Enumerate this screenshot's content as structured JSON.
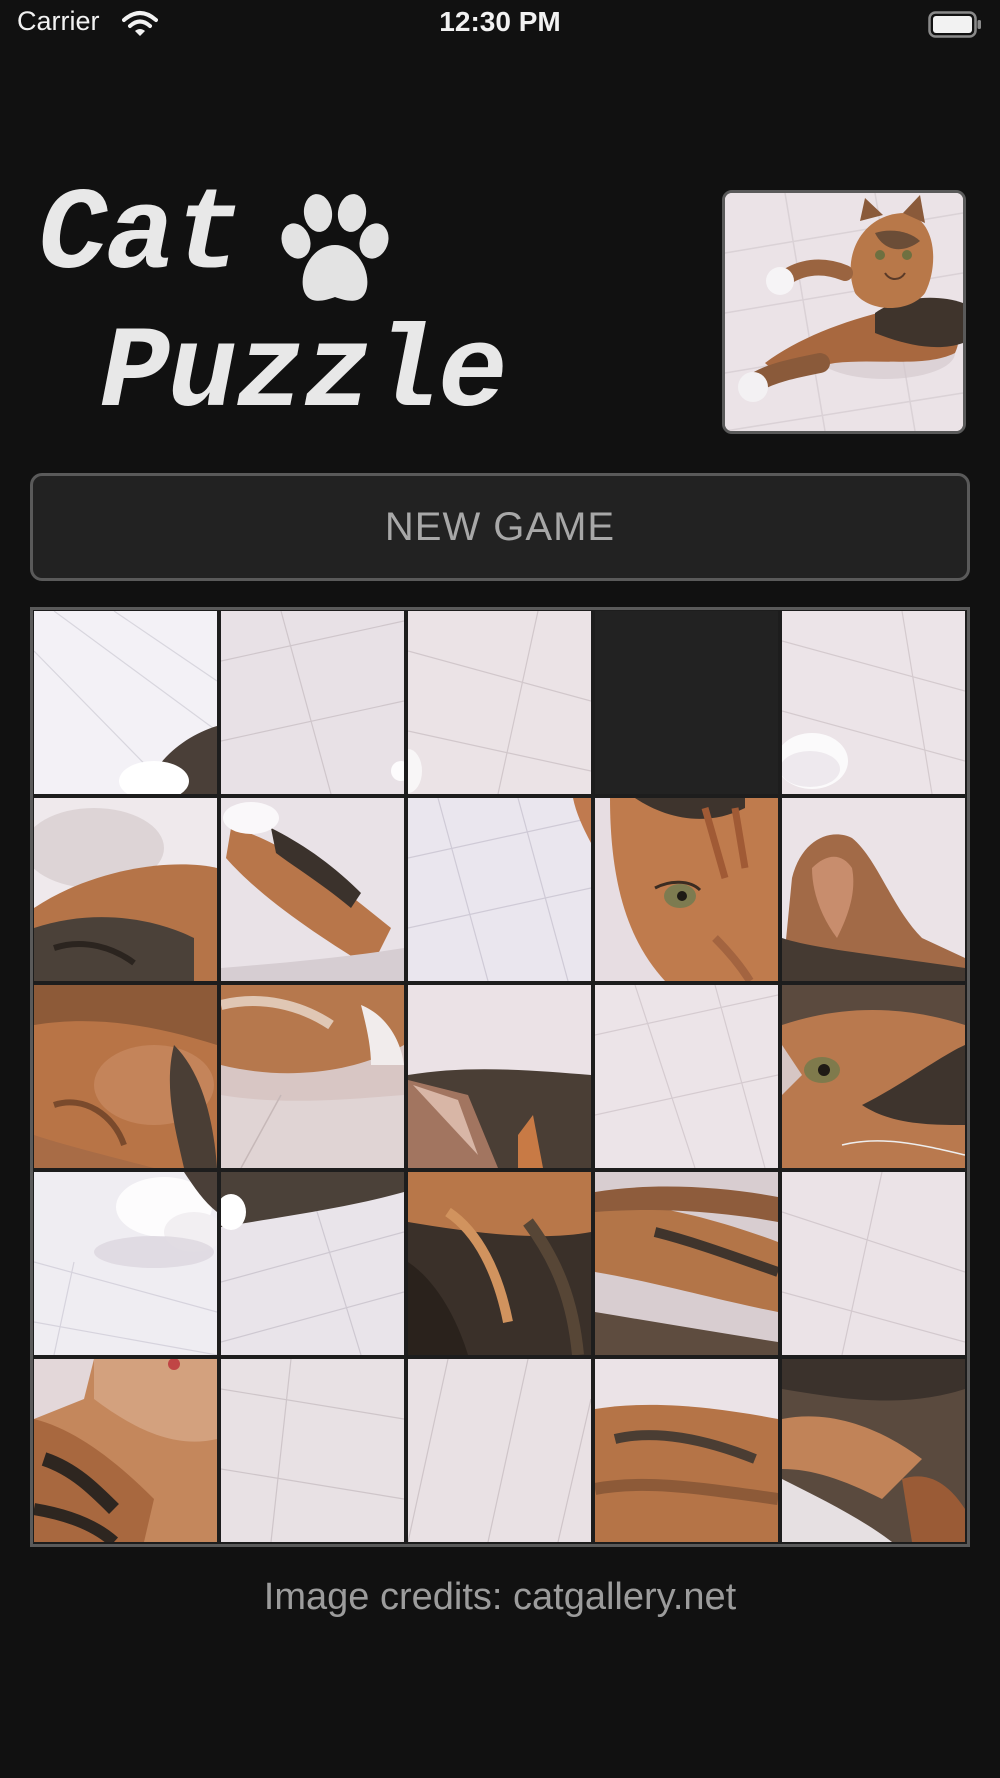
{
  "status_bar": {
    "carrier": "Carrier",
    "time": "12:30 PM"
  },
  "title": {
    "line1": "Cat",
    "line2": "Puzzle"
  },
  "new_game_button": {
    "label": "NEW GAME"
  },
  "credits": "Image credits: catgallery.net",
  "board": {
    "rows": 5,
    "columns": 5,
    "empty_position": {
      "row": 1,
      "col": 4
    },
    "tiles": [
      {
        "row": 1,
        "col": 1,
        "content": "floor with white paw"
      },
      {
        "row": 1,
        "col": 2,
        "content": "floor"
      },
      {
        "row": 1,
        "col": 3,
        "content": "floor"
      },
      {
        "row": 1,
        "col": 4,
        "content": "empty"
      },
      {
        "row": 1,
        "col": 5,
        "content": "floor with white paw"
      },
      {
        "row": 2,
        "col": 1,
        "content": "cat fur"
      },
      {
        "row": 2,
        "col": 2,
        "content": "cat leg"
      },
      {
        "row": 2,
        "col": 3,
        "content": "floor"
      },
      {
        "row": 2,
        "col": 4,
        "content": "cat face with eye"
      },
      {
        "row": 2,
        "col": 5,
        "content": "cat ear"
      },
      {
        "row": 3,
        "col": 1,
        "content": "cat fur"
      },
      {
        "row": 3,
        "col": 2,
        "content": "cat fur"
      },
      {
        "row": 3,
        "col": 3,
        "content": "cat ear"
      },
      {
        "row": 3,
        "col": 4,
        "content": "floor"
      },
      {
        "row": 3,
        "col": 5,
        "content": "cat face with eye"
      },
      {
        "row": 4,
        "col": 1,
        "content": "white paw on floor"
      },
      {
        "row": 4,
        "col": 2,
        "content": "floor with leg"
      },
      {
        "row": 4,
        "col": 3,
        "content": "cat fur"
      },
      {
        "row": 4,
        "col": 4,
        "content": "cat fur"
      },
      {
        "row": 4,
        "col": 5,
        "content": "floor"
      },
      {
        "row": 5,
        "col": 1,
        "content": "cat fur"
      },
      {
        "row": 5,
        "col": 2,
        "content": "floor"
      },
      {
        "row": 5,
        "col": 3,
        "content": "floor"
      },
      {
        "row": 5,
        "col": 4,
        "content": "cat fur"
      },
      {
        "row": 5,
        "col": 5,
        "content": "cat fur"
      }
    ]
  },
  "colors": {
    "background": "#111111",
    "floor": "#e9e1e6",
    "fur_orange": "#c07a4f",
    "fur_dark": "#3d342d",
    "fur_white": "#f4f2f4",
    "border": "#5a5a5a"
  }
}
